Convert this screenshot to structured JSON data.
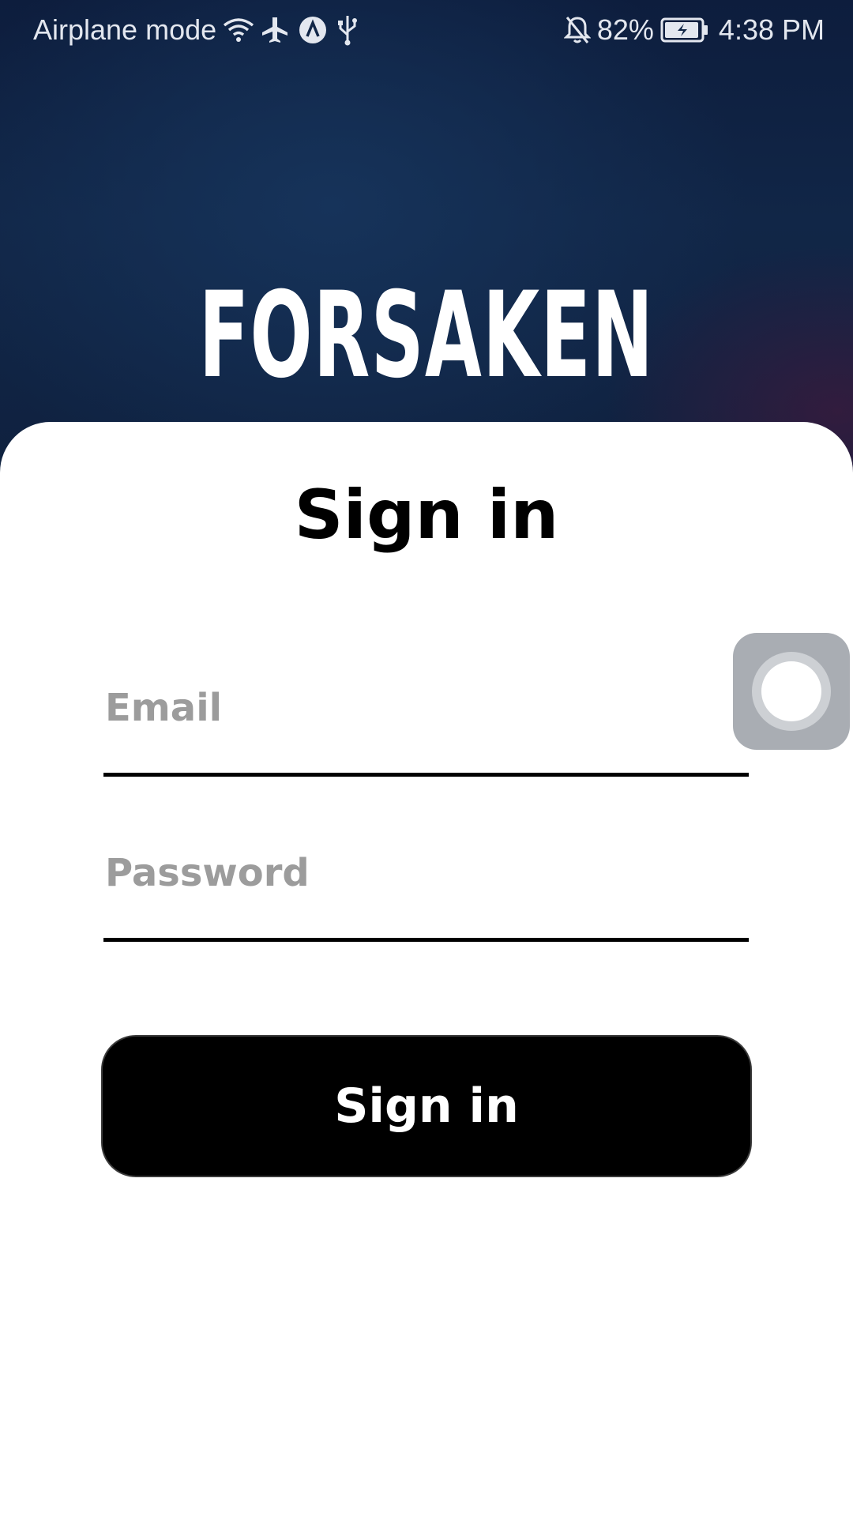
{
  "status_bar": {
    "mode_text": "Airplane mode",
    "battery_percent": "82%",
    "time": "4:38 PM",
    "icons": [
      "wifi-icon",
      "airplane-icon",
      "app-a-icon",
      "usb-icon",
      "bell-off-icon",
      "battery-charging-icon"
    ]
  },
  "brand": {
    "logo_text": "FORSAKEN"
  },
  "signin": {
    "title": "Sign in",
    "email_placeholder": "Email",
    "email_value": "",
    "password_placeholder": "Password",
    "password_value": "",
    "button_label": "Sign in"
  },
  "colors": {
    "hero_background": "#112647",
    "button_background": "#000000",
    "placeholder_text": "#9c9c9c",
    "assist_button": "#a9adb3"
  }
}
